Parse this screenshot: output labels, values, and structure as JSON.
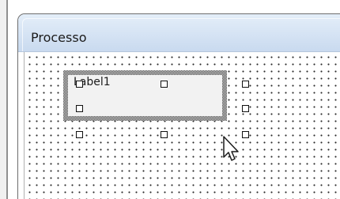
{
  "form": {
    "title": "Processo"
  },
  "label_control": {
    "caption": "Label1",
    "selected": true
  },
  "cursor": {
    "icon": "arrow-cursor-icon"
  }
}
